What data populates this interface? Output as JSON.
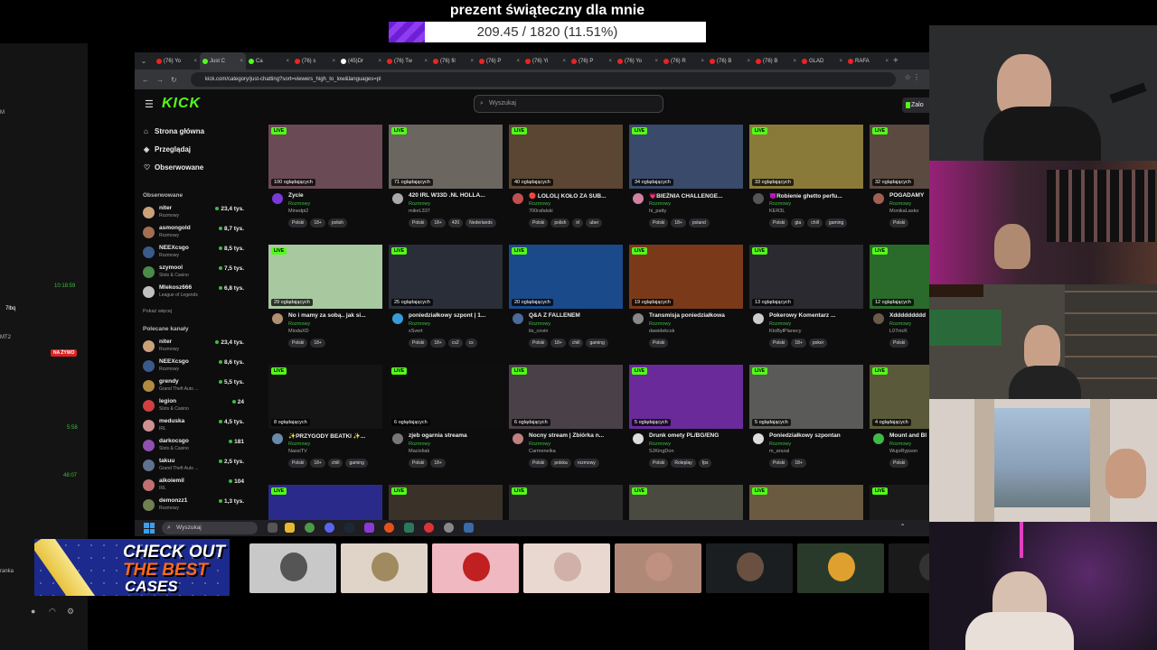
{
  "donation": {
    "title": "prezent świąteczny dla mnie",
    "text": "209.45 / 1820 (11.51%)",
    "progress": 0.1151
  },
  "chat_panel": {
    "times": [
      "10:18:59",
      "5:58",
      "48:07"
    ],
    "live_label": "NA ŻYWO",
    "names": [
      "M",
      "7lbq",
      "MT2"
    ],
    "footer_label": "ranka"
  },
  "browser": {
    "tabs": [
      "(76) Yo",
      "Just C",
      "Ca",
      "(76) s",
      "(45)Dr",
      "(76) Tw",
      "(76) fil",
      "(76) P",
      "(76) Yi",
      "(76) P",
      "(76) Yo",
      "(76) R",
      "(76) B",
      "(76) B",
      "GLAD",
      "RAFA"
    ],
    "url": "kick.com/category/just-chatting?sort=viewers_high_to_low&languages=pl"
  },
  "kick": {
    "logo": "KICK",
    "search_placeholder": "Wyszukaj",
    "login_label": "Zalo",
    "nav": [
      "Strona główna",
      "Przeglądaj",
      "Obserwowane"
    ],
    "followed_header": "Obserwowane",
    "show_more": "Pokaż więcej",
    "recommended_header": "Polecane kanały",
    "followed": [
      {
        "name": "niter",
        "cat": "Rozmowy",
        "viewers": "23,4 tys.",
        "color": "#c9a27a"
      },
      {
        "name": "asmongold",
        "cat": "Rozmowy",
        "viewers": "8,7 tys.",
        "color": "#a07050"
      },
      {
        "name": "NEEXcsgo",
        "cat": "Rozmowy",
        "viewers": "8,5 tys.",
        "color": "#3a5a8a"
      },
      {
        "name": "szymool",
        "cat": "Slots & Casino",
        "viewers": "7,5 tys.",
        "color": "#4a8a4a"
      },
      {
        "name": "Mlekosz666",
        "cat": "League of Legends",
        "viewers": "6,8 tys.",
        "color": "#c0c0c0"
      }
    ],
    "recommended": [
      {
        "name": "niter",
        "cat": "Rozmowy",
        "viewers": "23,4 tys.",
        "color": "#c9a27a"
      },
      {
        "name": "NEEXcsgo",
        "cat": "Rozmowy",
        "viewers": "8,6 tys.",
        "color": "#3a5a8a"
      },
      {
        "name": "grendy",
        "cat": "Grand Theft Auto ...",
        "viewers": "5,5 tys.",
        "color": "#b08a40"
      },
      {
        "name": "legion",
        "cat": "Slots & Casino",
        "viewers": "24",
        "color": "#d04040"
      },
      {
        "name": "meduska",
        "cat": "IRL",
        "viewers": "4,5 tys.",
        "color": "#d09090"
      },
      {
        "name": "darkocsgo",
        "cat": "Slots & Casino",
        "viewers": "181",
        "color": "#9050b0"
      },
      {
        "name": "takuu",
        "cat": "Grand Theft Auto ...",
        "viewers": "2,5 tys.",
        "color": "#607090"
      },
      {
        "name": "aikoiemil",
        "cat": "IRL",
        "viewers": "104",
        "color": "#c07070"
      },
      {
        "name": "demonzz1",
        "cat": "Rozmowy",
        "viewers": "1,3 tys.",
        "color": "#708050"
      }
    ],
    "live_label": "LIVE",
    "cards": [
      {
        "viewers": "100 oglądających",
        "title": "Życie",
        "cat": "Rozmowy",
        "streamer": "Minedpi2",
        "tags": [
          "Polski",
          "18+",
          "polish"
        ],
        "thumb": "#6a4a55",
        "av": "#7a3ad8"
      },
      {
        "viewers": "71 oglądających",
        "title": "420 IRL W33D .NL HOLLA...",
        "cat": "Rozmowy",
        "streamer": "mikeL337",
        "tags": [
          "Polski",
          "18+",
          "420",
          "Nederlands"
        ],
        "thumb": "#6b6660",
        "av": "#aaaaaa"
      },
      {
        "viewers": "40 oglądających",
        "title": "🔴 LOLOL| KOŁO ZA SUB...",
        "cat": "Rozmowy",
        "streamer": "700rafalski",
        "tags": [
          "Polski",
          "polish",
          "irl",
          "uber"
        ],
        "thumb": "#5a4632",
        "av": "#c05050"
      },
      {
        "viewers": "34 oglądających",
        "title": "💗BIEŻNIA CHALLENGE...",
        "cat": "Rozmowy",
        "streamer": "hi_patty",
        "tags": [
          "Polski",
          "18+",
          "poland"
        ],
        "thumb": "#3a4a6a",
        "av": "#d080a0"
      },
      {
        "viewers": "33 oglądających",
        "title": "😈Robienie ghetto perfu...",
        "cat": "Rozmowy",
        "streamer": "KER3L",
        "tags": [
          "Polski",
          "gta",
          "chill",
          "gaming"
        ],
        "thumb": "#8a7a3a",
        "av": "#555555"
      },
      {
        "viewers": "32 oglądających",
        "title": "POGADAMY",
        "cat": "Rozmowy",
        "streamer": "MonikaLasko",
        "tags": [
          "Polski"
        ],
        "thumb": "#5a4a40",
        "av": "#a06050"
      },
      {
        "viewers": "29 oglądających",
        "title": "No i mamy za sobą.. jak si...",
        "cat": "Rozmowy",
        "streamer": "MiodaXD",
        "tags": [
          "Polski",
          "18+"
        ],
        "thumb": "#a8c8a0",
        "av": "#b09070"
      },
      {
        "viewers": "25 oglądających",
        "title": "poniedziałkowy szpont | 1...",
        "cat": "Rozmowy",
        "streamer": "xSvert",
        "tags": [
          "Polski",
          "18+",
          "cs2",
          "cs"
        ],
        "thumb": "#2a2e38",
        "av": "#3a9ad8"
      },
      {
        "viewers": "20 oglądających",
        "title": "Q&A Z FALLENEM",
        "cat": "Rozmowy",
        "streamer": "its_covin",
        "tags": [
          "Polski",
          "18+",
          "chill",
          "gaming"
        ],
        "thumb": "#1a4a8a",
        "av": "#4a6a9a"
      },
      {
        "viewers": "19 oglądających",
        "title": "Transmisja poniedziałkowa",
        "cat": "Rozmowy",
        "streamer": "dawidekcsk",
        "tags": [
          "Polski"
        ],
        "thumb": "#7a3a1a",
        "av": "#888888"
      },
      {
        "viewers": "13 oglądających",
        "title": "Pokerowy Komentarz ...",
        "cat": "Rozmowy",
        "streamer": "KtoByłPlanecy",
        "tags": [
          "Polski",
          "18+",
          "poker"
        ],
        "thumb": "#2a2a30",
        "av": "#cccccc"
      },
      {
        "viewers": "12 oglądających",
        "title": "Xddddddddd",
        "cat": "Rozmowy",
        "streamer": "L07nicK",
        "tags": [
          "Polski"
        ],
        "thumb": "#2a6a2a",
        "av": "#6a5a4a"
      },
      {
        "viewers": "8 oglądających",
        "title": "✨PRZYGODY BEATKI ✨...",
        "cat": "Rozmowy",
        "streamer": "NassiTV",
        "tags": [
          "Polski",
          "18+",
          "chill",
          "gaming"
        ],
        "thumb": "#141414",
        "av": "#6a8aaa"
      },
      {
        "viewers": "6 oglądających",
        "title": "zjeb ogarnia streama",
        "cat": "Rozmowy",
        "streamer": "MacioIiak",
        "tags": [
          "Polski",
          "18+"
        ],
        "thumb": "#0e0e0e",
        "av": "#777777"
      },
      {
        "viewers": "6 oglądających",
        "title": "Nocny stream | Zbiórka n...",
        "cat": "Rozmowy",
        "streamer": "Carmenelka",
        "tags": [
          "Polski",
          "polska",
          "rozmowy"
        ],
        "thumb": "#4a4048",
        "av": "#c08080"
      },
      {
        "viewers": "5 oglądających",
        "title": "Drunk omety PL/BG/ENG",
        "cat": "Rozmowy",
        "streamer": "SJKingDon",
        "tags": [
          "Polski",
          "Roleplay",
          "fps"
        ],
        "thumb": "#6a2a9a",
        "av": "#dddddd"
      },
      {
        "viewers": "5 oglądających",
        "title": "Poniedziałkowy szpontan",
        "cat": "Rozmowy",
        "streamer": "m_arszal",
        "tags": [
          "Polski",
          "18+"
        ],
        "thumb": "#5a5a58",
        "av": "#dddddd"
      },
      {
        "viewers": "4 oglądających",
        "title": "Mount and Bl",
        "cat": "Rozmowy",
        "streamer": "WujoRypson",
        "tags": [
          "Polski"
        ],
        "thumb": "#5a5a3a",
        "av": "#3fba45"
      },
      {
        "viewers": "",
        "title": "",
        "cat": "",
        "streamer": "",
        "tags": [],
        "thumb": "#2a2a8a",
        "av": "#333333"
      },
      {
        "viewers": "",
        "title": "",
        "cat": "",
        "streamer": "",
        "tags": [],
        "thumb": "#3a3228",
        "av": "#333333"
      },
      {
        "viewers": "",
        "title": "",
        "cat": "",
        "streamer": "",
        "tags": [],
        "thumb": "#2a2a2a",
        "av": "#333333"
      },
      {
        "viewers": "",
        "title": "",
        "cat": "",
        "streamer": "",
        "tags": [],
        "thumb": "#4a4a40",
        "av": "#333333"
      },
      {
        "viewers": "",
        "title": "",
        "cat": "",
        "streamer": "",
        "tags": [],
        "thumb": "#6a5a40",
        "av": "#333333"
      },
      {
        "viewers": "",
        "title": "",
        "cat": "",
        "streamer": "",
        "tags": [],
        "thumb": "#1a1a1a",
        "av": "#333333"
      }
    ]
  },
  "taskbar": {
    "search": "Wyszukaj"
  },
  "ad": {
    "line1": "CHECK OUT",
    "line2": "THE BEST",
    "line3": "CASES"
  },
  "emotes": [
    "#c8c8c8",
    "#e0d4c8",
    "#f0b8c0",
    "#e8d8d0",
    "#b08878",
    "#1a1e20",
    "#2a3a2a",
    "#1a1a1a"
  ],
  "colors": {
    "kick_green": "#53fc18",
    "donation_purple": "#6c1fd6",
    "live_red": "#dd2222"
  }
}
